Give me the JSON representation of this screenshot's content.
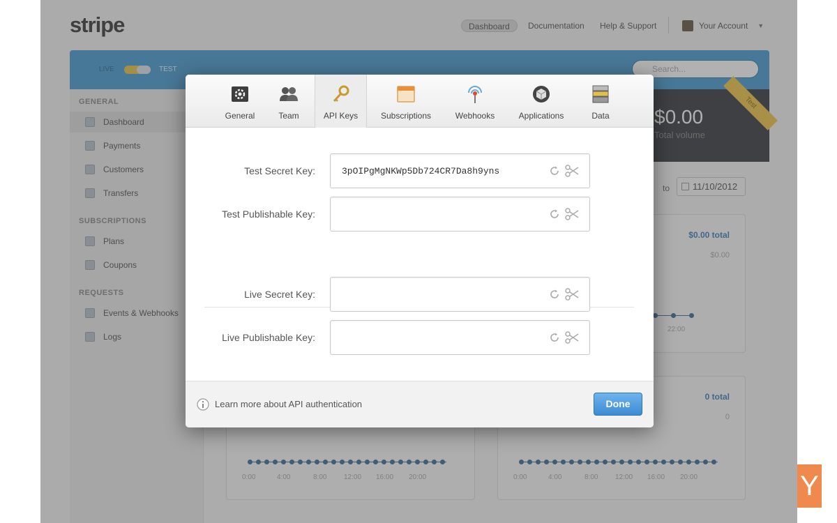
{
  "app": {
    "logo": "stripe"
  },
  "top_nav": {
    "dashboard": "Dashboard",
    "documentation": "Documentation",
    "help": "Help & Support",
    "account": "Your Account"
  },
  "mode_bar": {
    "live_label": "LIVE",
    "test_label": "TEST",
    "search_placeholder": "Search..."
  },
  "sidebar": {
    "sections": [
      {
        "heading": "GENERAL",
        "items": [
          "Dashboard",
          "Payments",
          "Customers",
          "Transfers"
        ]
      },
      {
        "heading": "SUBSCRIPTIONS",
        "items": [
          "Plans",
          "Coupons"
        ]
      },
      {
        "heading": "REQUESTS",
        "items": [
          "Events & Webhooks",
          "Logs"
        ]
      }
    ],
    "active_item": "Dashboard"
  },
  "summary": {
    "amount": "$0.00",
    "label": "Total volume",
    "badge": "Test"
  },
  "date_range": {
    "to_label": "to",
    "end_date": "11/10/2012"
  },
  "panels": {
    "right_top": {
      "total": "$0.00 total",
      "zero": "$0.00",
      "tick": "22:00"
    },
    "left_bottom": {
      "ticks": [
        "0:00",
        "4:00",
        "8:00",
        "12:00",
        "16:00",
        "20:00"
      ]
    },
    "right_bottom": {
      "total": "0 total",
      "zero": "0",
      "ticks": [
        "0:00",
        "4:00",
        "8:00",
        "12:00",
        "16:00",
        "20:00"
      ]
    }
  },
  "modal": {
    "tabs": [
      {
        "label": "General",
        "icon": "gear-icon"
      },
      {
        "label": "Team",
        "icon": "team-icon"
      },
      {
        "label": "API Keys",
        "icon": "key-icon",
        "active": true
      },
      {
        "label": "Subscriptions",
        "icon": "subscriptions-icon"
      },
      {
        "label": "Webhooks",
        "icon": "webhooks-icon"
      },
      {
        "label": "Applications",
        "icon": "applications-icon"
      },
      {
        "label": "Data",
        "icon": "data-icon"
      }
    ],
    "keys": [
      {
        "label": "Test Secret Key:",
        "value": "3pOIPgMgNKWp5Db724CR7Da8h9yns"
      },
      {
        "label": "Test Publishable Key:",
        "value": ""
      },
      {
        "label": "Live Secret Key:",
        "value": ""
      },
      {
        "label": "Live Publishable Key:",
        "value": ""
      }
    ],
    "footer": {
      "learn_more": "Learn more about API authentication",
      "done_label": "Done"
    }
  },
  "corner_tab": {
    "text": "Y",
    "color": "#f0894d"
  },
  "colors": {
    "accent_blue": "#4b9ed3",
    "done_button": "#3c8bd3",
    "test_badge": "#f1c74a"
  }
}
